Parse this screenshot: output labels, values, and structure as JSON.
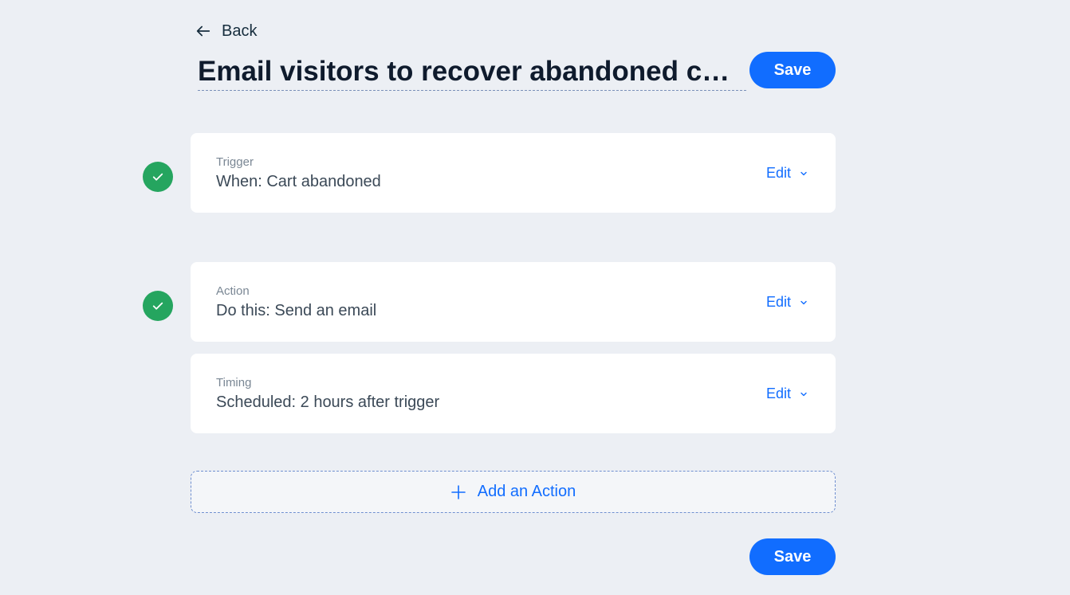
{
  "header": {
    "back_label": "Back",
    "title": "Email visitors to recover abandoned c…",
    "save_label": "Save"
  },
  "steps": [
    {
      "label": "Trigger",
      "value": "When: Cart abandoned",
      "edit_label": "Edit",
      "status": "complete"
    },
    {
      "label": "Action",
      "value": "Do this: Send an email",
      "edit_label": "Edit",
      "status": "complete"
    },
    {
      "label": "Timing",
      "value": "Scheduled: 2 hours after trigger",
      "edit_label": "Edit"
    }
  ],
  "add_action_label": "Add an Action",
  "footer": {
    "save_label": "Save"
  },
  "colors": {
    "accent": "#116dff",
    "success": "#25a55f",
    "background": "#eceff4"
  },
  "icons": {
    "back": "arrow-left-icon",
    "check": "check-icon",
    "chevron": "chevron-down-icon",
    "plus": "plus-icon"
  }
}
